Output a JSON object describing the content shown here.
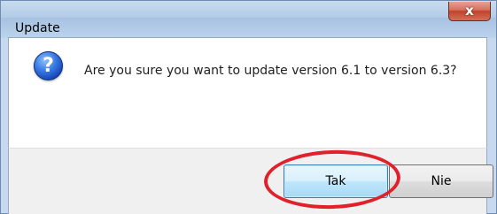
{
  "window": {
    "title": "Update",
    "close_glyph": "x"
  },
  "dialog": {
    "icon": "question-icon",
    "question_glyph": "?",
    "message": "Are you sure you want to update version 6.1 to version 6.3?"
  },
  "buttons": {
    "yes_label": "Tak",
    "no_label": "Nie"
  },
  "colors": {
    "close_button": "#c1432c",
    "focused_button_border": "#3c7fb1",
    "annotation_ring": "#e0202a"
  }
}
